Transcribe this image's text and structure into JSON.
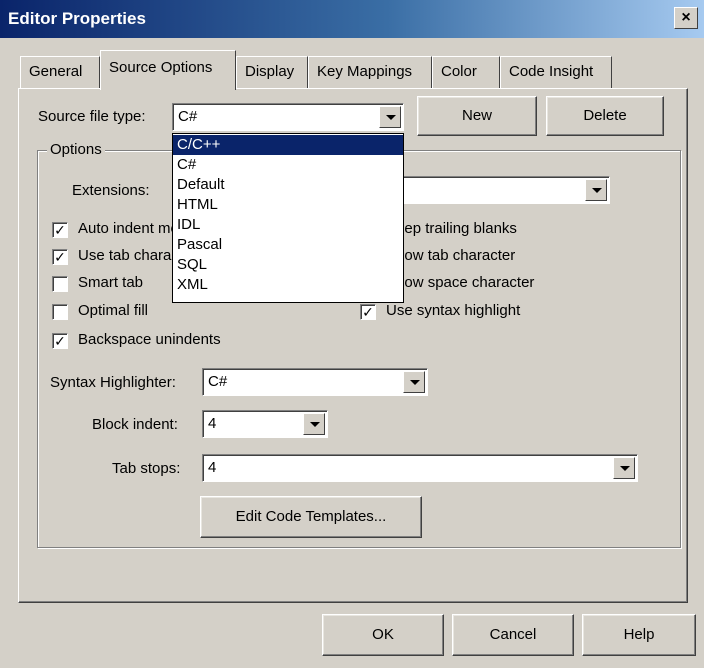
{
  "window": {
    "title": "Editor Properties",
    "close_glyph": "×"
  },
  "tabs": [
    "General",
    "Source Options",
    "Display",
    "Key Mappings",
    "Color",
    "Code Insight"
  ],
  "active_tab": "Source Options",
  "source_file_type": {
    "label": "Source file type:",
    "value": "C#"
  },
  "buttons": {
    "new": "New",
    "delete": "Delete",
    "edit_templates": "Edit Code Templates...",
    "ok": "OK",
    "cancel": "Cancel",
    "help": "Help"
  },
  "options_group": {
    "title": "Options"
  },
  "extensions": {
    "label": "Extensions:",
    "value": ""
  },
  "checkboxes_left": [
    {
      "label": "Auto indent mode",
      "checked": true
    },
    {
      "label": "Use tab character",
      "checked": true
    },
    {
      "label": "Smart tab",
      "checked": false
    },
    {
      "label": "Optimal fill",
      "checked": false
    },
    {
      "label": "Backspace unindents",
      "checked": true
    }
  ],
  "checkboxes_right": [
    {
      "label": "Keep trailing blanks",
      "checked": false
    },
    {
      "label": "Show tab character",
      "checked": false
    },
    {
      "label": "Show space character",
      "checked": false
    },
    {
      "label": "Use syntax highlight",
      "checked": true
    }
  ],
  "syntax_highlighter": {
    "label": "Syntax Highlighter:",
    "value": "C#"
  },
  "block_indent": {
    "label": "Block indent:",
    "value": "4"
  },
  "tab_stops": {
    "label": "Tab stops:",
    "value": "4"
  },
  "dropdown_items": [
    "C/C++",
    "C#",
    "Default",
    "HTML",
    "IDL",
    "Pascal",
    "SQL",
    "XML"
  ],
  "dropdown_selected": "C/C++",
  "check_glyph": "✓"
}
